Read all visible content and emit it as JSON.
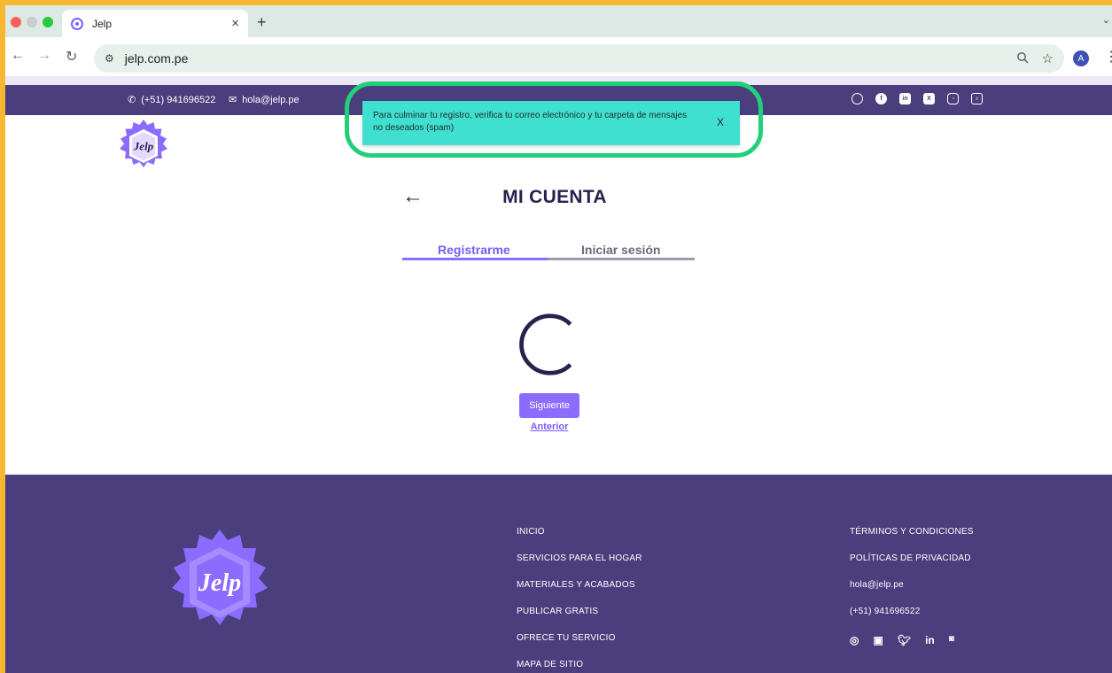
{
  "browser": {
    "tab_title": "Jelp",
    "tab_close": "×",
    "new_tab": "+",
    "url": "jelp.com.pe",
    "avatar_letter": "A",
    "traffic_colors": [
      "#FF5F57",
      "#FEBC2E",
      "#28C840"
    ]
  },
  "topbar": {
    "phone": "(+51) 941696522",
    "email": "hola@jelp.pe",
    "socials": [
      "whatsapp-icon",
      "facebook-icon",
      "linkedin-icon",
      "x-icon",
      "instagram-icon",
      "tiktok-icon"
    ]
  },
  "toast": {
    "message": "Para culminar tu registro, verifica tu correo electrónico y tu carpeta de mensajes no deseados (spam)",
    "close_label": "X"
  },
  "logo": {
    "text": "Jelp"
  },
  "main": {
    "title": "MI CUENTA",
    "tabs": [
      {
        "label": "Registrarme",
        "active": true
      },
      {
        "label": "Iniciar sesión",
        "active": false
      }
    ],
    "next_label": "Siguiente",
    "prev_label": "Anterior"
  },
  "footer": {
    "nav": [
      "INICIO",
      "SERVICIOS PARA EL HOGAR",
      "MATERIALES Y ACABADOS",
      "PUBLICAR GRATIS",
      "OFRECE TU SERVICIO",
      "MAPA DE SITIO"
    ],
    "legal": [
      "TÉRMINOS Y CONDICIONES",
      "POLÍTICAS DE PRIVACIDAD"
    ],
    "email": "hola@jelp.pe",
    "phone": "(+51) 941696522",
    "socials": [
      "whatsapp-icon",
      "facebook-icon",
      "twitter-icon",
      "linkedin-icon",
      "instagram-icon"
    ]
  },
  "colors": {
    "brand_purple": "#4A3E7D",
    "accent": "#8C6CFF",
    "toast_bg": "#40E0D0",
    "highlight_ring": "#21D07A",
    "outer_border": "#F7B731"
  }
}
